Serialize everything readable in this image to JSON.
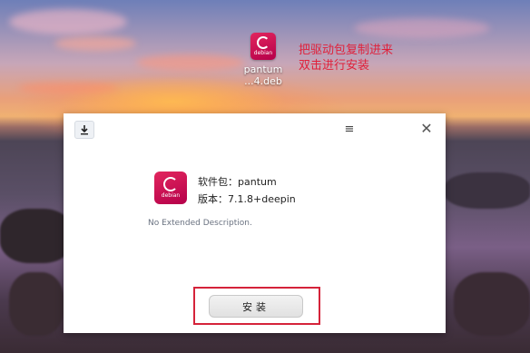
{
  "desktop": {
    "icon_name": "pantum",
    "icon_subname": "...4.deb",
    "icon_badge": "debian",
    "annotation_line1": "把驱动包复制进来",
    "annotation_line2": "双击进行安装",
    "annotation_color": "#e0203a"
  },
  "dialog": {
    "app_icon": "download-arrow-icon",
    "menu_glyph": "≡",
    "close_glyph": "✕",
    "package_badge": "debian",
    "package_label": "软件包：pantum",
    "version_label": "版本：7.1.8+deepin",
    "description": "No Extended Description.",
    "install_button": "安装",
    "highlight_color": "#d5233a"
  }
}
